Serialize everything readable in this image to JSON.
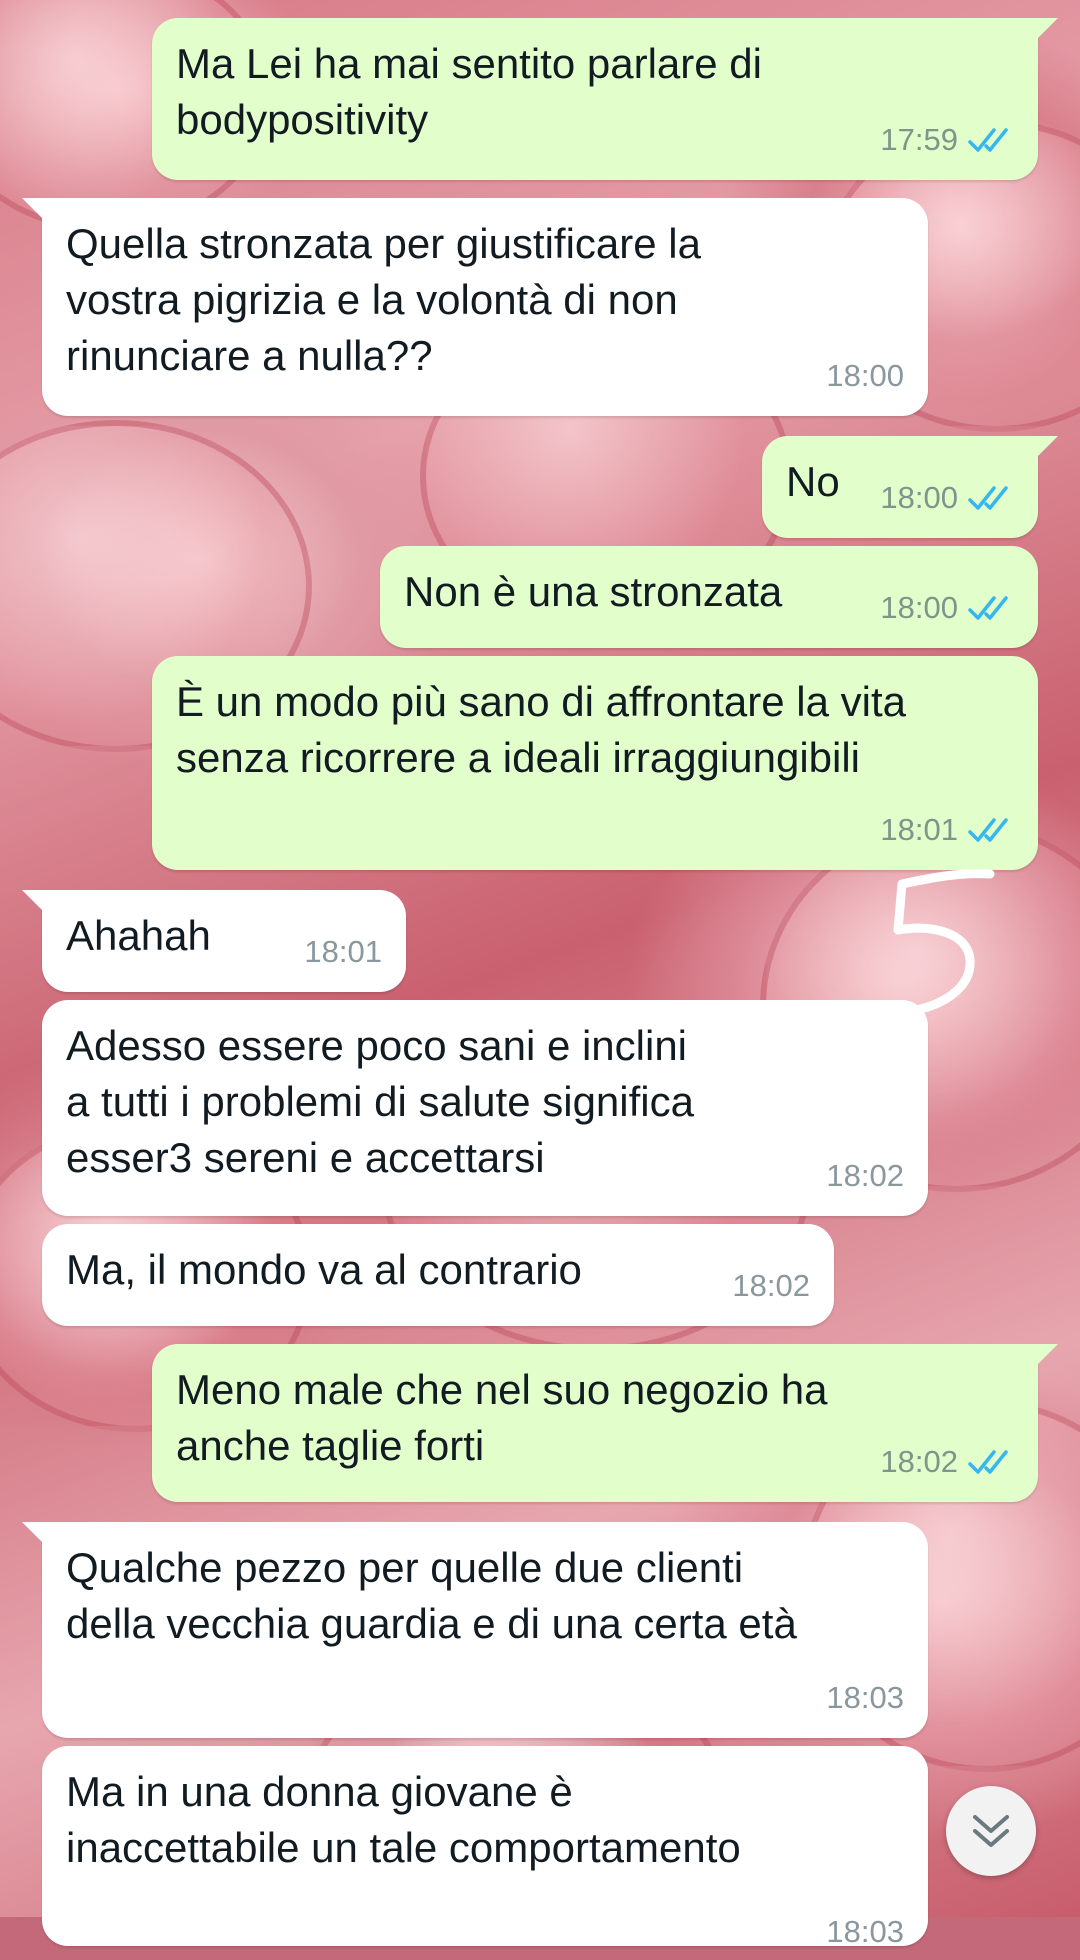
{
  "messages": [
    {
      "direction": "outgoing",
      "text": "Ma Lei ha mai sentito parlare di\nbodypositivity",
      "time": "17:59",
      "status": "read"
    },
    {
      "direction": "incoming",
      "text": "Quella stronzata per giustificare la\nvostra pigrizia e la volontà di non\nrinunciare a nulla??",
      "time": "18:00"
    },
    {
      "direction": "outgoing",
      "text": "No",
      "time": "18:00",
      "status": "read"
    },
    {
      "direction": "outgoing",
      "text": "Non è una stronzata",
      "time": "18:00",
      "status": "read"
    },
    {
      "direction": "outgoing",
      "text": "È un modo più sano di affrontare la vita\nsenza ricorrere a ideali irraggiungibili",
      "time": "18:01",
      "status": "read"
    },
    {
      "direction": "incoming",
      "text": "Ahahah",
      "time": "18:01"
    },
    {
      "direction": "incoming",
      "text": "Adesso essere poco sani e inclini\na tutti i problemi di salute significa\nesser3 sereni e accettarsi",
      "time": "18:02"
    },
    {
      "direction": "incoming",
      "text": "Ma, il mondo va al contrario",
      "time": "18:02"
    },
    {
      "direction": "outgoing",
      "text": "Meno male che nel suo negozio ha\nanche taglie forti",
      "time": "18:02",
      "status": "read"
    },
    {
      "direction": "incoming",
      "text": "Qualche pezzo per quelle due clienti\ndella vecchia guardia e di una certa età",
      "time": "18:03"
    },
    {
      "direction": "incoming",
      "text": "Ma in una donna giovane è\ninaccettabile un tale comportamento",
      "time": "18:03"
    }
  ],
  "colors": {
    "outgoing_bubble": "#e2fecb",
    "incoming_bubble": "#ffffff",
    "read_ticks": "#34b7f1",
    "timestamp": "#8a979e"
  },
  "icons": {
    "read_status": "double-check-icon",
    "scroll_down": "double-chevron-down-icon",
    "annotation": "hand-drawn-number-icon"
  }
}
